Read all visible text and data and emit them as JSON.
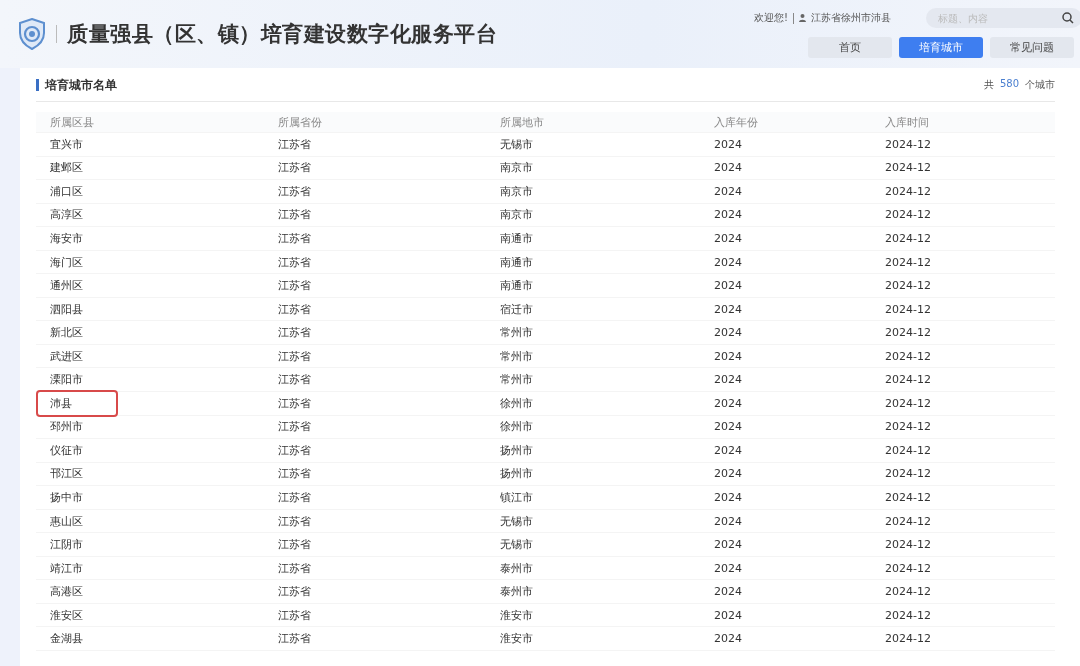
{
  "header": {
    "title": "质量强县（区、镇）培育建设数字化服务平台",
    "welcome": "欢迎您!",
    "user": "江苏省徐州市沛县",
    "search": {
      "placeholder": "标题、内容"
    },
    "tabs": [
      {
        "label": "首页",
        "selected": false
      },
      {
        "label": "培育城市",
        "selected": true
      },
      {
        "label": "常见问题",
        "selected": false
      }
    ]
  },
  "panel": {
    "title": "培育城市名单",
    "count_prefix": "共",
    "count": "580",
    "count_suffix": "个城市"
  },
  "table": {
    "columns": [
      "所属区县",
      "所属省份",
      "所属地市",
      "入库年份",
      "入库时间"
    ],
    "rows": [
      {
        "cells": [
          "宜兴市",
          "江苏省",
          "无锡市",
          "2024",
          "2024-12"
        ],
        "highlighted": false
      },
      {
        "cells": [
          "建邺区",
          "江苏省",
          "南京市",
          "2024",
          "2024-12"
        ],
        "highlighted": false
      },
      {
        "cells": [
          "浦口区",
          "江苏省",
          "南京市",
          "2024",
          "2024-12"
        ],
        "highlighted": false
      },
      {
        "cells": [
          "高淳区",
          "江苏省",
          "南京市",
          "2024",
          "2024-12"
        ],
        "highlighted": false
      },
      {
        "cells": [
          "海安市",
          "江苏省",
          "南通市",
          "2024",
          "2024-12"
        ],
        "highlighted": false
      },
      {
        "cells": [
          "海门区",
          "江苏省",
          "南通市",
          "2024",
          "2024-12"
        ],
        "highlighted": false
      },
      {
        "cells": [
          "通州区",
          "江苏省",
          "南通市",
          "2024",
          "2024-12"
        ],
        "highlighted": false
      },
      {
        "cells": [
          "泗阳县",
          "江苏省",
          "宿迁市",
          "2024",
          "2024-12"
        ],
        "highlighted": false
      },
      {
        "cells": [
          "新北区",
          "江苏省",
          "常州市",
          "2024",
          "2024-12"
        ],
        "highlighted": false
      },
      {
        "cells": [
          "武进区",
          "江苏省",
          "常州市",
          "2024",
          "2024-12"
        ],
        "highlighted": false
      },
      {
        "cells": [
          "溧阳市",
          "江苏省",
          "常州市",
          "2024",
          "2024-12"
        ],
        "highlighted": false
      },
      {
        "cells": [
          "沛县",
          "江苏省",
          "徐州市",
          "2024",
          "2024-12"
        ],
        "highlighted": true
      },
      {
        "cells": [
          "邳州市",
          "江苏省",
          "徐州市",
          "2024",
          "2024-12"
        ],
        "highlighted": false
      },
      {
        "cells": [
          "仪征市",
          "江苏省",
          "扬州市",
          "2024",
          "2024-12"
        ],
        "highlighted": false
      },
      {
        "cells": [
          "邗江区",
          "江苏省",
          "扬州市",
          "2024",
          "2024-12"
        ],
        "highlighted": false
      },
      {
        "cells": [
          "扬中市",
          "江苏省",
          "镇江市",
          "2024",
          "2024-12"
        ],
        "highlighted": false
      },
      {
        "cells": [
          "惠山区",
          "江苏省",
          "无锡市",
          "2024",
          "2024-12"
        ],
        "highlighted": false
      },
      {
        "cells": [
          "江阴市",
          "江苏省",
          "无锡市",
          "2024",
          "2024-12"
        ],
        "highlighted": false
      },
      {
        "cells": [
          "靖江市",
          "江苏省",
          "泰州市",
          "2024",
          "2024-12"
        ],
        "highlighted": false
      },
      {
        "cells": [
          "高港区",
          "江苏省",
          "泰州市",
          "2024",
          "2024-12"
        ],
        "highlighted": false
      },
      {
        "cells": [
          "淮安区",
          "江苏省",
          "淮安市",
          "2024",
          "2024-12"
        ],
        "highlighted": false
      },
      {
        "cells": [
          "金湖县",
          "江苏省",
          "淮安市",
          "2024",
          "2024-12"
        ],
        "highlighted": false
      }
    ]
  }
}
